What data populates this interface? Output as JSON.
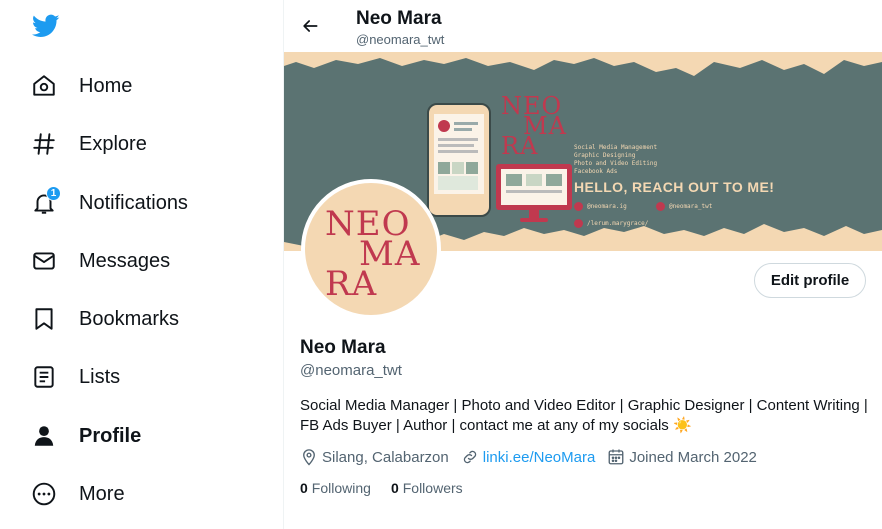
{
  "colors": {
    "accent": "#1d9bf0",
    "banner": "#5b7372",
    "banner_paper": "#f4d8b3",
    "avatar_text": "#c0394f"
  },
  "sidebar": {
    "items": [
      {
        "label": "Home",
        "icon": "home-icon"
      },
      {
        "label": "Explore",
        "icon": "hashtag-icon"
      },
      {
        "label": "Notifications",
        "icon": "bell-icon",
        "badge": "1"
      },
      {
        "label": "Messages",
        "icon": "envelope-icon"
      },
      {
        "label": "Bookmarks",
        "icon": "bookmark-icon"
      },
      {
        "label": "Lists",
        "icon": "list-icon"
      },
      {
        "label": "Profile",
        "icon": "person-icon",
        "active": true
      },
      {
        "label": "More",
        "icon": "more-circle-icon"
      }
    ]
  },
  "header": {
    "name": "Neo Mara",
    "handle": "@neomara_twt"
  },
  "banner": {
    "brand_lines": [
      "NEO",
      "MA",
      "RA"
    ],
    "services": [
      "Social Media Management",
      "Graphic Designing",
      "Photo and Video Editing",
      "Facebook Ads"
    ],
    "headline": "HELLO, REACH OUT TO ME!",
    "contacts": [
      "@neomara.ig",
      "@neomara_twt",
      "/lerum.marygrace/"
    ]
  },
  "avatar": {
    "lines": [
      "NEO",
      "MA",
      "RA"
    ]
  },
  "profile": {
    "edit_label": "Edit profile",
    "name": "Neo Mara",
    "handle": "@neomara_twt",
    "bio_line1": "Social Media Manager | Photo and Video Editor | Graphic Designer | Content Writing |",
    "bio_line2": "FB Ads Buyer | Author | contact me at any of my socials",
    "bio_emoji": "☀️",
    "location": "Silang, Calabarzon",
    "link": "linki.ee/NeoMara",
    "joined": "Joined March 2022",
    "following_count": "0",
    "following_label": "Following",
    "followers_count": "0",
    "followers_label": "Followers"
  }
}
